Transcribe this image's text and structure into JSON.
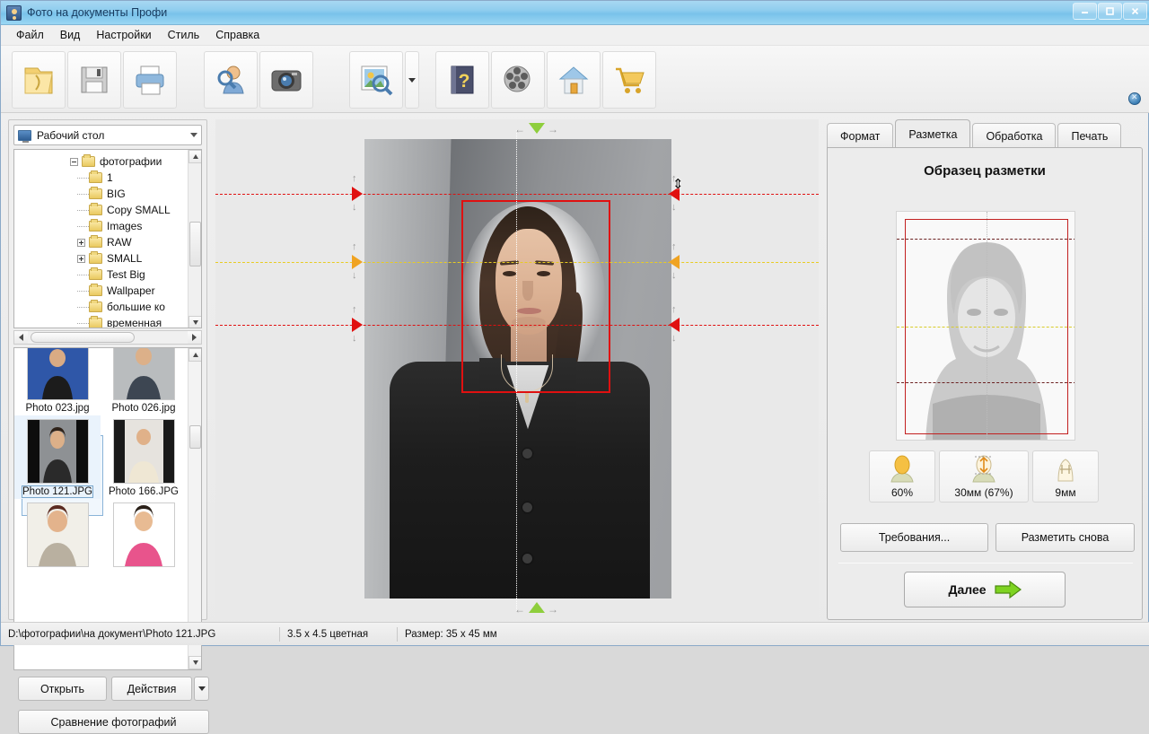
{
  "window": {
    "title": "Фото на документы Профи",
    "icon": "app-photo-icon",
    "controls": {
      "minimize": "—",
      "maximize": "▢",
      "close": "✕"
    }
  },
  "menu": {
    "items": [
      "Файл",
      "Вид",
      "Настройки",
      "Стиль",
      "Справка"
    ]
  },
  "toolbar": {
    "buttons": [
      {
        "name": "open-file-button",
        "icon": "folder-open-icon"
      },
      {
        "name": "save-button",
        "icon": "floppy-disk-icon"
      },
      {
        "name": "print-button",
        "icon": "printer-icon"
      },
      {
        "name": "find-person-button",
        "icon": "person-search-icon"
      },
      {
        "name": "camera-button",
        "icon": "camera-icon"
      },
      {
        "name": "image-search-button",
        "icon": "image-search-icon"
      },
      {
        "name": "help-button",
        "icon": "help-book-icon"
      },
      {
        "name": "video-button",
        "icon": "film-reel-icon"
      },
      {
        "name": "home-button",
        "icon": "home-icon"
      },
      {
        "name": "store-button",
        "icon": "shopping-cart-icon"
      }
    ],
    "dropdown_caret": "▾",
    "corner_close": "✕"
  },
  "left_panel": {
    "location_combo": {
      "value": "Рабочий стол",
      "caret": "▾",
      "icon": "monitor-icon"
    },
    "tree": [
      {
        "label": "фотографии",
        "indent": 0,
        "expander": "minus"
      },
      {
        "label": "1",
        "indent": 1,
        "expander": "none"
      },
      {
        "label": "BIG",
        "indent": 1,
        "expander": "none"
      },
      {
        "label": "Copy SMALL",
        "indent": 1,
        "expander": "none"
      },
      {
        "label": "Images",
        "indent": 1,
        "expander": "none"
      },
      {
        "label": "RAW",
        "indent": 1,
        "expander": "plus"
      },
      {
        "label": "SMALL",
        "indent": 1,
        "expander": "plus"
      },
      {
        "label": "Test Big",
        "indent": 1,
        "expander": "none"
      },
      {
        "label": "Wallpaper",
        "indent": 1,
        "expander": "none"
      },
      {
        "label": "большие ко",
        "indent": 1,
        "expander": "none"
      },
      {
        "label": "временная",
        "indent": 1,
        "expander": "none"
      }
    ],
    "thumbnails": [
      {
        "caption": "Photo 023.jpg",
        "selected": false
      },
      {
        "caption": "Photo 026.jpg",
        "selected": false
      },
      {
        "caption": "Photo 121.JPG",
        "selected": true
      },
      {
        "caption": "Photo 166.JPG",
        "selected": false
      }
    ],
    "buttons": {
      "open": "Открыть",
      "actions": "Действия",
      "actions_caret": "▾",
      "compare": "Сравнение фотографий"
    }
  },
  "right_panel": {
    "tabs": [
      {
        "label": "Формат",
        "active": false
      },
      {
        "label": "Разметка",
        "active": true
      },
      {
        "label": "Обработка",
        "active": false
      },
      {
        "label": "Печать",
        "active": false
      }
    ],
    "section_title": "Образец разметки",
    "metrics": [
      {
        "value": "60%",
        "icon": "head-height-icon"
      },
      {
        "value": "30мм (67%)",
        "icon": "face-size-icon"
      },
      {
        "value": "9мм",
        "icon": "top-margin-icon"
      }
    ],
    "buttons": {
      "requirements": "Требования...",
      "remark": "Разметить снова",
      "next": "Далее",
      "next_arrow": "arrow-right-green-icon"
    }
  },
  "status_bar": {
    "path": "D:\\фотографии\\на документ\\Photo 121.JPG",
    "format": "3.5 x 4.5 цветная",
    "size": "Размер: 35 x 45 мм"
  },
  "colors": {
    "crop_rect": "#e01010",
    "eye_line": "#e8cc22",
    "marker_green": "#8ece3c",
    "marker_orange": "#f0a321",
    "title_gradient_top": "#a8d8f2"
  }
}
